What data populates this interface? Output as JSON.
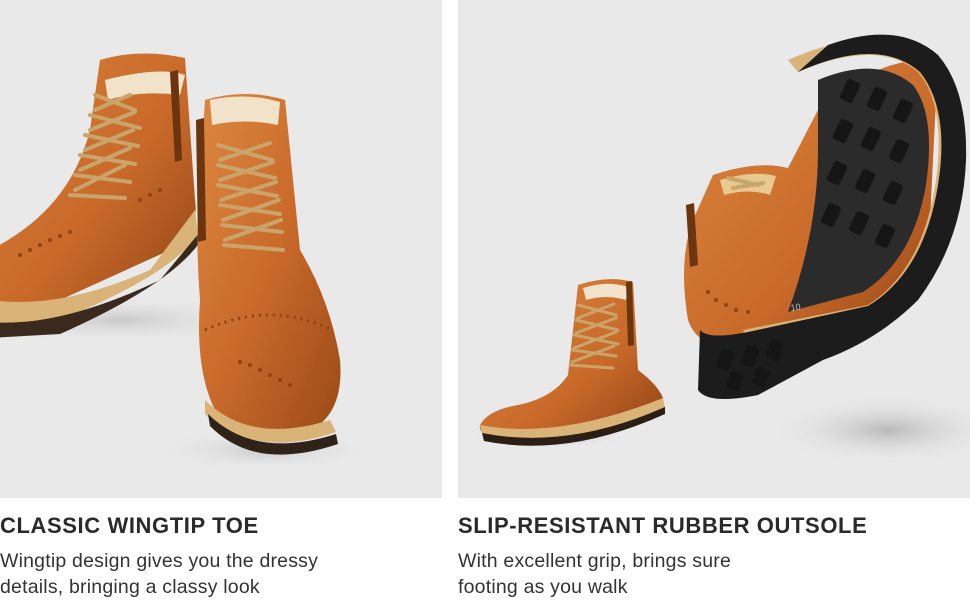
{
  "left": {
    "image": {
      "subject": "pair of brown wingtip lace-up boots",
      "icon": "boot-photo"
    },
    "title": "CLASSIC WINGTIP TOE",
    "description_lines": [
      "Wingtip design gives you the dressy",
      "details, bringing a classy look"
    ]
  },
  "right": {
    "image": {
      "subject": "brown wingtip boot beside a tilted boot showing its black lug sole",
      "icon": "outsole-photo",
      "sole_mark": "10"
    },
    "title": "SLIP-RESISTANT RUBBER OUTSOLE",
    "description_lines": [
      "With excellent grip, brings sure",
      "footing as you walk"
    ]
  },
  "colors": {
    "background": "#ffffff",
    "photo_background": "#e9e9ea",
    "leather": "#c8692a",
    "leather_dark": "#9a4a17",
    "lace": "#c9a46b",
    "sole": "#1c1c1c",
    "title_text": "#2a2a2a",
    "body_text": "#333333"
  }
}
